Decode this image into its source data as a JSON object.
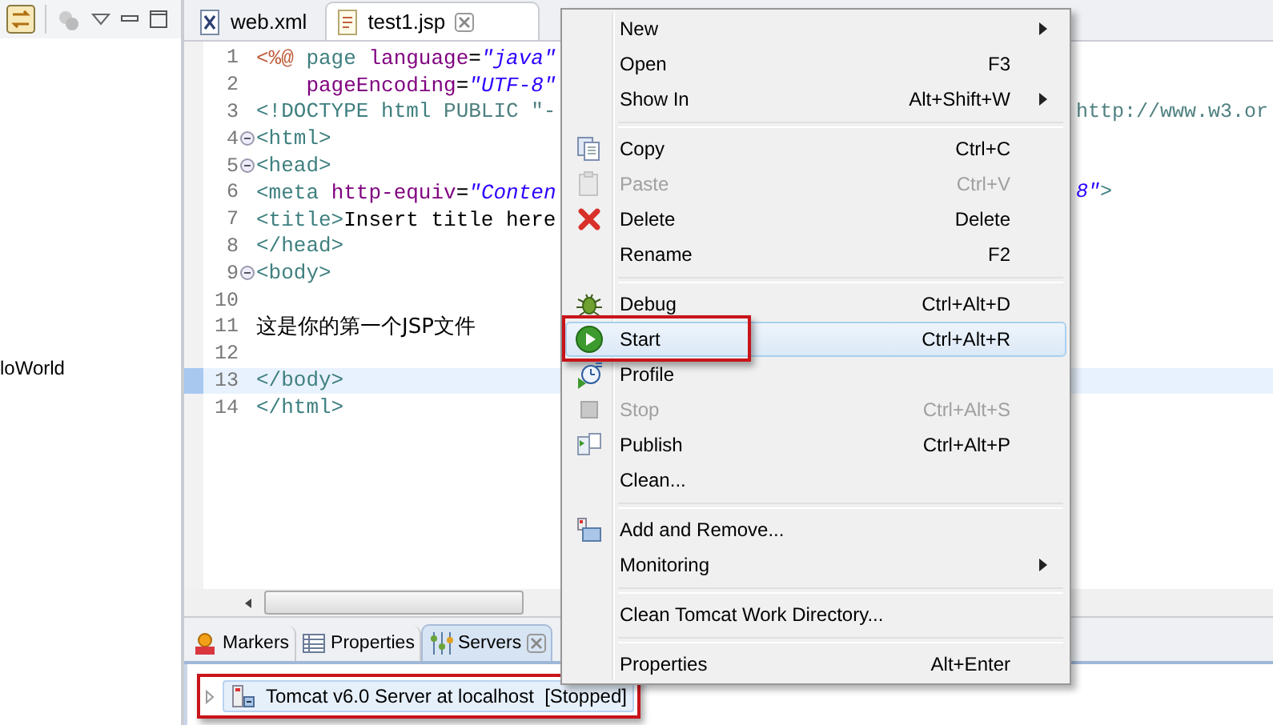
{
  "left_panel": {
    "items": [
      {
        "label": "loWorld"
      }
    ]
  },
  "editor": {
    "tabs": [
      {
        "label": "web.xml",
        "kind": "xml",
        "selected": false,
        "closable": false
      },
      {
        "label": "test1.jsp",
        "kind": "jsp",
        "selected": true,
        "closable": true
      }
    ],
    "lines": [
      {
        "number": "1",
        "fold": false,
        "current": false,
        "tokens": [
          {
            "kind": "jsp",
            "text": "<%@"
          },
          {
            "kind": "tag",
            "text": " page"
          },
          {
            "kind": "attr",
            "text": " language"
          },
          {
            "kind": "plain",
            "text": "="
          },
          {
            "kind": "value",
            "text": "\"java\""
          }
        ]
      },
      {
        "number": "2",
        "fold": false,
        "current": false,
        "tokens": [
          {
            "kind": "attr",
            "text": "    pageEncoding"
          },
          {
            "kind": "plain",
            "text": "="
          },
          {
            "kind": "value",
            "text": "\"UTF-8\""
          }
        ]
      },
      {
        "number": "3",
        "fold": false,
        "current": false,
        "tokens": [
          {
            "kind": "tag",
            "text": "<!DOCTYPE html"
          },
          {
            "kind": "doctype",
            "text": " PUBLIC \"-"
          }
        ],
        "tail": [
          {
            "kind": "doctype",
            "text": "http://www.w3.or"
          }
        ]
      },
      {
        "number": "4",
        "fold": true,
        "current": false,
        "tokens": [
          {
            "kind": "tag",
            "text": "<html>"
          }
        ]
      },
      {
        "number": "5",
        "fold": true,
        "current": false,
        "tokens": [
          {
            "kind": "tag",
            "text": "<head>"
          }
        ]
      },
      {
        "number": "6",
        "fold": false,
        "current": false,
        "tokens": [
          {
            "kind": "tag",
            "text": "<meta"
          },
          {
            "kind": "attr",
            "text": " http-equiv"
          },
          {
            "kind": "plain",
            "text": "="
          },
          {
            "kind": "value",
            "text": "\"Conten"
          }
        ],
        "tail": [
          {
            "kind": "value",
            "text": "8\""
          },
          {
            "kind": "tag",
            "text": ">"
          }
        ]
      },
      {
        "number": "7",
        "fold": false,
        "current": false,
        "tokens": [
          {
            "kind": "tag",
            "text": "<title>"
          },
          {
            "kind": "plain",
            "text": "Insert title here"
          }
        ]
      },
      {
        "number": "8",
        "fold": false,
        "current": false,
        "tokens": [
          {
            "kind": "tag",
            "text": "</head>"
          }
        ]
      },
      {
        "number": "9",
        "fold": true,
        "current": false,
        "tokens": [
          {
            "kind": "tag",
            "text": "<body>"
          }
        ]
      },
      {
        "number": "10",
        "fold": false,
        "current": false
      },
      {
        "number": "11",
        "fold": false,
        "current": false,
        "tokens": [
          {
            "kind": "plain",
            "text": "这是你的第一个JSP文件"
          }
        ]
      },
      {
        "number": "12",
        "fold": false,
        "current": false
      },
      {
        "number": "13",
        "fold": false,
        "current": true,
        "tokens": [
          {
            "kind": "tag",
            "text": "</body>"
          }
        ]
      },
      {
        "number": "14",
        "fold": false,
        "current": false,
        "tokens": [
          {
            "kind": "tag",
            "text": "</html>"
          }
        ]
      }
    ]
  },
  "context_menu": {
    "groups": [
      [
        {
          "label": "New",
          "kind": "plain",
          "submenu": true,
          "disabled": false,
          "selected": false,
          "callout": false
        },
        {
          "label": "Open",
          "shortcut": "F3",
          "kind": "plain",
          "submenu": false,
          "disabled": false,
          "selected": false,
          "callout": false
        },
        {
          "label": "Show In",
          "shortcut": "Alt+Shift+W",
          "kind": "plain",
          "submenu": true,
          "disabled": false,
          "selected": false,
          "callout": false
        }
      ],
      [
        {
          "label": "Copy",
          "shortcut": "Ctrl+C",
          "kind": "copy",
          "submenu": false,
          "disabled": false,
          "selected": false,
          "callout": false
        },
        {
          "label": "Paste",
          "shortcut": "Ctrl+V",
          "kind": "paste",
          "submenu": false,
          "disabled": true,
          "selected": false,
          "callout": false
        },
        {
          "label": "Delete",
          "shortcut": "Delete",
          "kind": "delete",
          "submenu": false,
          "disabled": false,
          "selected": false,
          "callout": false
        },
        {
          "label": "Rename",
          "shortcut": "F2",
          "kind": "plain",
          "submenu": false,
          "disabled": false,
          "selected": false,
          "callout": false
        }
      ],
      [
        {
          "label": "Debug",
          "shortcut": "Ctrl+Alt+D",
          "kind": "debug",
          "submenu": false,
          "disabled": false,
          "selected": false,
          "callout": false
        },
        {
          "label": "Start",
          "shortcut": "Ctrl+Alt+R",
          "kind": "start",
          "submenu": false,
          "disabled": false,
          "selected": true,
          "callout": true
        },
        {
          "label": "Profile",
          "kind": "profile",
          "submenu": false,
          "disabled": false,
          "selected": false,
          "callout": false
        },
        {
          "label": "Stop",
          "shortcut": "Ctrl+Alt+S",
          "kind": "stop",
          "submenu": false,
          "disabled": true,
          "selected": false,
          "callout": false
        },
        {
          "label": "Publish",
          "shortcut": "Ctrl+Alt+P",
          "kind": "publish",
          "submenu": false,
          "disabled": false,
          "selected": false,
          "callout": false
        },
        {
          "label": "Clean...",
          "kind": "plain",
          "submenu": false,
          "disabled": false,
          "selected": false,
          "callout": false
        }
      ],
      [
        {
          "label": "Add and Remove...",
          "kind": "add",
          "submenu": false,
          "disabled": false,
          "selected": false,
          "callout": false
        },
        {
          "label": "Monitoring",
          "kind": "plain",
          "submenu": true,
          "disabled": false,
          "selected": false,
          "callout": false
        }
      ],
      [
        {
          "label": "Clean Tomcat Work Directory...",
          "kind": "plain",
          "submenu": false,
          "disabled": false,
          "selected": false,
          "callout": false
        }
      ],
      [
        {
          "label": "Properties",
          "shortcut": "Alt+Enter",
          "kind": "plain",
          "submenu": false,
          "disabled": false,
          "selected": false,
          "callout": false
        }
      ]
    ]
  },
  "bottom_panel": {
    "tabs": [
      {
        "label": "Markers",
        "kind": "markers",
        "selected": false,
        "closable": false
      },
      {
        "label": "Properties",
        "kind": "properties",
        "selected": false,
        "closable": false
      },
      {
        "label": "Servers",
        "kind": "servers",
        "selected": true,
        "closable": true
      }
    ],
    "servers": [
      {
        "name": "Tomcat v6.0 Server at localhost",
        "status": "[Stopped]",
        "expanded": false,
        "callout": true
      }
    ]
  }
}
